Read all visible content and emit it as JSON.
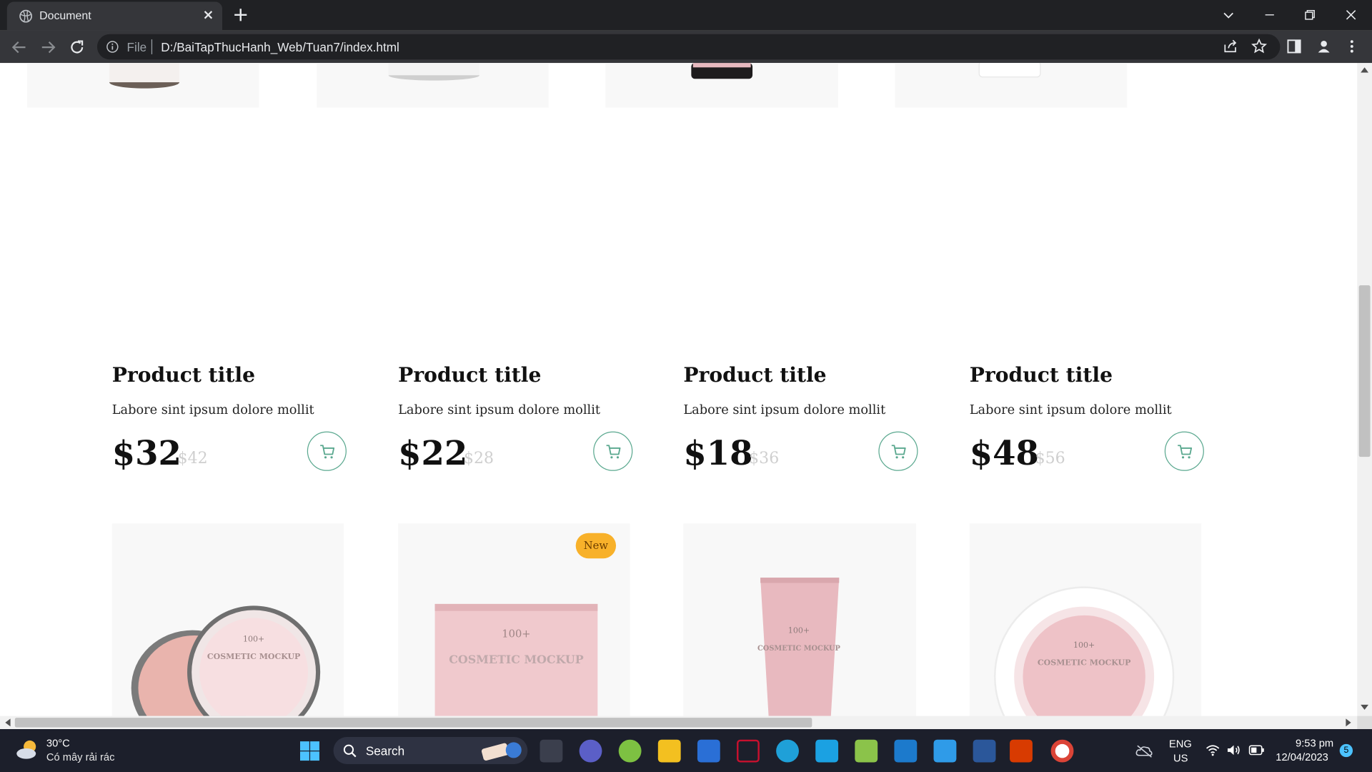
{
  "browser": {
    "tab_title": "Document",
    "url_scheme": "File",
    "url": "D:/BaiTapThucHanh_Web/Tuan7/index.html"
  },
  "products": [
    {
      "title": "Product title",
      "description": "Labore sint ipsum dolore mollit",
      "price": "$32",
      "old_price": "$42"
    },
    {
      "title": "Product title",
      "description": "Labore sint ipsum dolore mollit",
      "price": "$22",
      "old_price": "$28"
    },
    {
      "title": "Product title",
      "description": "Labore sint ipsum dolore mollit",
      "price": "$18",
      "old_price": "$36"
    },
    {
      "title": "Product title",
      "description": "Labore sint ipsum dolore mollit",
      "price": "$48",
      "old_price": "$56"
    }
  ],
  "next_row": {
    "badge_label": "New",
    "product_images": [
      "jar-image",
      "box-image",
      "tube-image",
      "round-jar-image"
    ],
    "mockup_text": "COSMETIC MOCKUP",
    "mockup_count": "100+"
  },
  "taskbar": {
    "weather_temp": "30°C",
    "weather_desc": "Có mây rải rác",
    "search_label": "Search",
    "lang_line1": "ENG",
    "lang_line2": "US",
    "time": "9:53 pm",
    "date": "12/04/2023",
    "notification_count": "5"
  },
  "colors": {
    "accent_green": "#5aa88f",
    "badge_yellow": "#f8b12a",
    "old_price_gray": "#cfcfcf"
  }
}
